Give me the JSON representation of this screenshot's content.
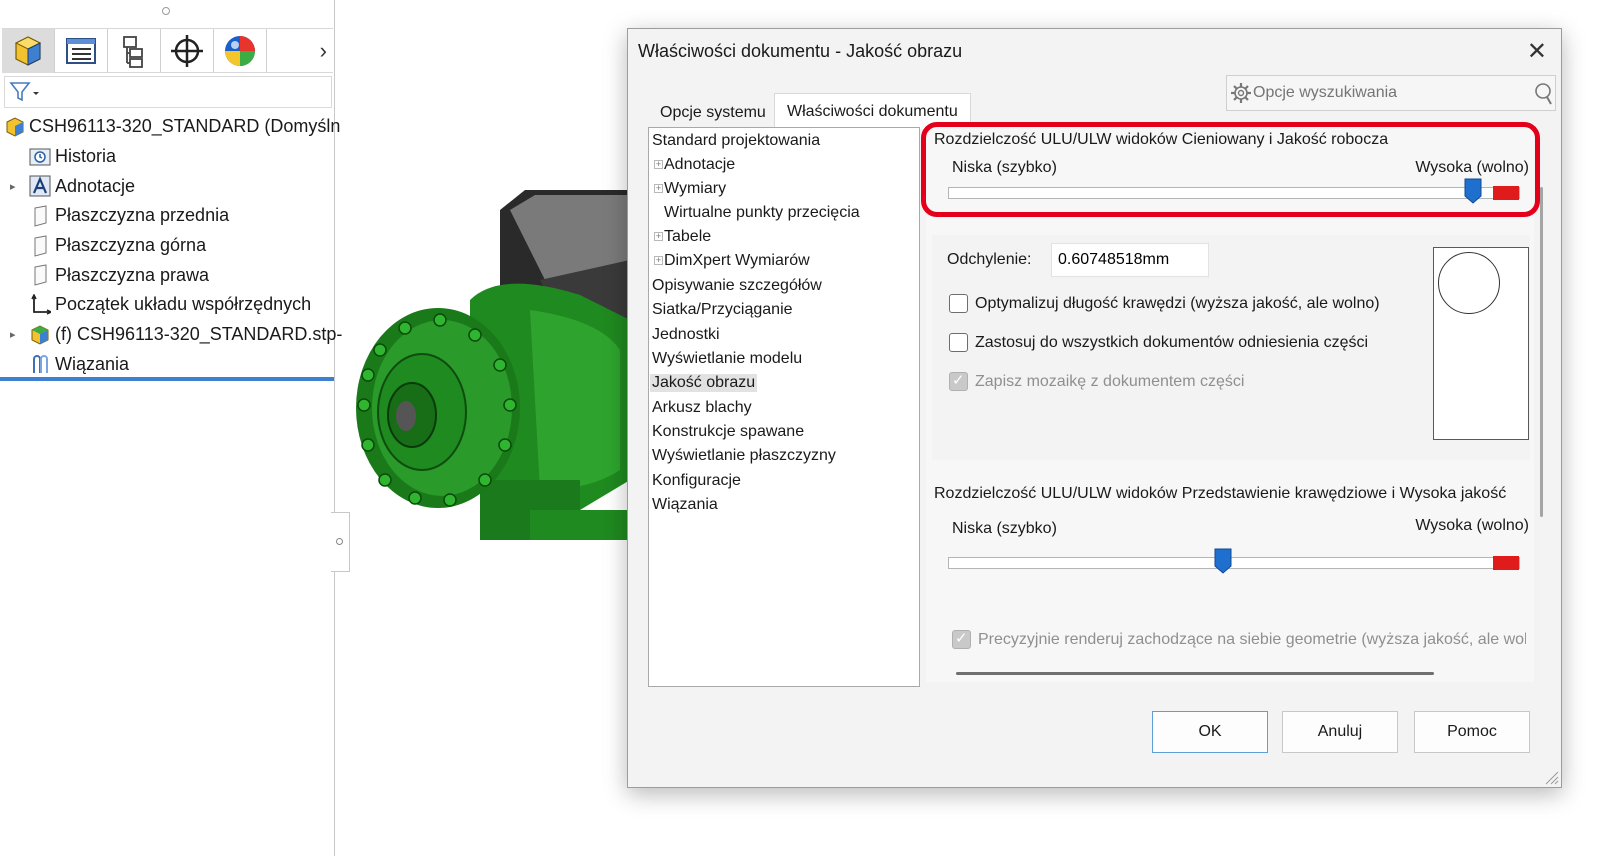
{
  "feature_tree": {
    "root": "CSH96113-320_STANDARD (Domyśln",
    "items": [
      {
        "label": "Historia",
        "icon": "history-icon"
      },
      {
        "label": "Adnotacje",
        "icon": "annotations-icon"
      },
      {
        "label": "Płaszczyzna przednia",
        "icon": "plane-icon"
      },
      {
        "label": "Płaszczyzna górna",
        "icon": "plane-icon"
      },
      {
        "label": "Płaszczyzna prawa",
        "icon": "plane-icon"
      },
      {
        "label": "Początek układu współrzędnych",
        "icon": "origin-icon"
      },
      {
        "label": "(f) CSH96113-320_STANDARD.stp-",
        "icon": "imported-part-icon"
      },
      {
        "label": "Wiązania",
        "icon": "mates-icon"
      }
    ],
    "toolbar_icons": [
      "feature-manager-icon",
      "property-manager-icon",
      "configuration-manager-icon",
      "dimxpert-manager-icon",
      "display-manager-icon"
    ]
  },
  "dialog": {
    "title": "Właściwości dokumentu - Jakość obrazu",
    "search_placeholder": "Opcje wyszukiwania",
    "tabs": [
      "Opcje systemu",
      "Właściwości dokumentu"
    ],
    "active_tab": "Właściwości dokumentu",
    "nav_items": [
      {
        "label": "Standard projektowania"
      },
      {
        "label": "Adnotacje"
      },
      {
        "label": "Wymiary"
      },
      {
        "label": "Wirtualne punkty przecięcia"
      },
      {
        "label": "Tabele"
      },
      {
        "label": "DimXpert Wymiarów"
      },
      {
        "label": "Opisywanie szczegółów"
      },
      {
        "label": "Siatka/Przyciąganie"
      },
      {
        "label": "Jednostki"
      },
      {
        "label": "Wyświetlanie modelu"
      },
      {
        "label": "Jakość obrazu"
      },
      {
        "label": "Arkusz blachy"
      },
      {
        "label": "Konstrukcje spawane"
      },
      {
        "label": "Wyświetlanie płaszczyzny"
      },
      {
        "label": "Konfiguracje"
      },
      {
        "label": "Wiązania"
      }
    ],
    "selected_nav": "Jakość obrazu",
    "shaded_group": {
      "title": "Rozdzielczość ULU/ULW widoków Cieniowany i Jakość robocza",
      "low_label": "Niska (szybko)",
      "high_label": "Wysoka (wolno)",
      "slider_value": 0.92
    },
    "deviation": {
      "label": "Odchylenie:",
      "value": "0.60748518mm"
    },
    "checkboxes": [
      {
        "label": "Optymalizuj długość krawędzi (wyższa jakość, ale wolno)",
        "checked": false,
        "disabled": false
      },
      {
        "label": "Zastosuj do wszystkich dokumentów odniesienia części",
        "checked": false,
        "disabled": false
      },
      {
        "label": "Zapisz mozaikę z dokumentem części",
        "checked": true,
        "disabled": true
      }
    ],
    "wireframe_group": {
      "title": "Rozdzielczość ULU/ULW widoków Przedstawienie krawędziowe i Wysoka jakość",
      "low_label": "Niska (szybko)",
      "high_label": "Wysoka (wolno)",
      "slider_value": 0.48
    },
    "precise_checkbox": {
      "label": "Precyzyjnie renderuj zachodzące na siebie geometrie (wyższa jakość, ale wolr",
      "checked": true,
      "disabled": true
    },
    "buttons": {
      "ok": "OK",
      "cancel": "Anuluj",
      "help": "Pomoc"
    }
  },
  "colors": {
    "highlight": "#e4001b",
    "slider_thumb": "#1f6fcf",
    "slider_red": "#e01b1b",
    "model_green": "#1f8a1f",
    "tree_selection": "#3d7fd1"
  }
}
